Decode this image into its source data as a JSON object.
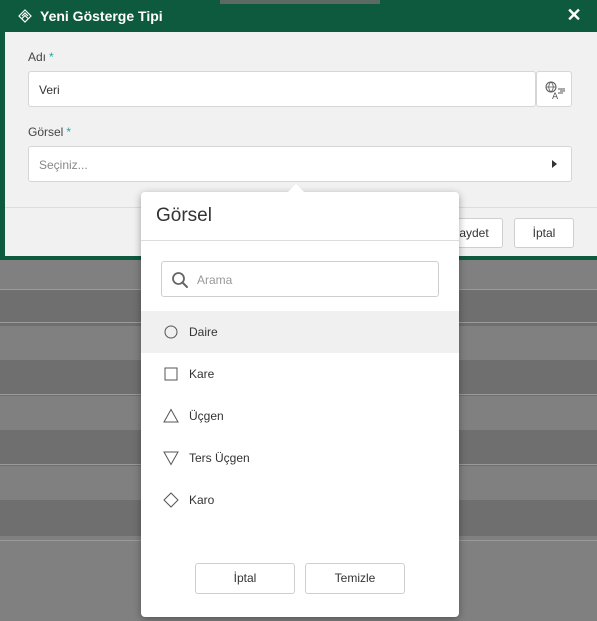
{
  "dialog": {
    "title": "Yeni Gösterge Tipi",
    "close_icon": "close-icon",
    "fields": {
      "name_label": "Adı",
      "name_value": "Veri",
      "required_mark": "*",
      "visual_label": "Görsel",
      "visual_placeholder": "Seçiniz..."
    },
    "footer": {
      "save_label": "aydet",
      "cancel_label": "İptal"
    }
  },
  "popup": {
    "title": "Görsel",
    "search_placeholder": "Arama",
    "options": [
      {
        "label": "Daire",
        "icon": "circle-icon"
      },
      {
        "label": "Kare",
        "icon": "square-icon"
      },
      {
        "label": "Üçgen",
        "icon": "triangle-icon"
      },
      {
        "label": "Ters Üçgen",
        "icon": "inverted-triangle-icon"
      },
      {
        "label": "Karo",
        "icon": "diamond-icon"
      }
    ],
    "cancel_label": "İptal",
    "clear_label": "Temizle"
  },
  "colors": {
    "titlebar": "#0e5a3e",
    "required": "#2aa7a0"
  }
}
